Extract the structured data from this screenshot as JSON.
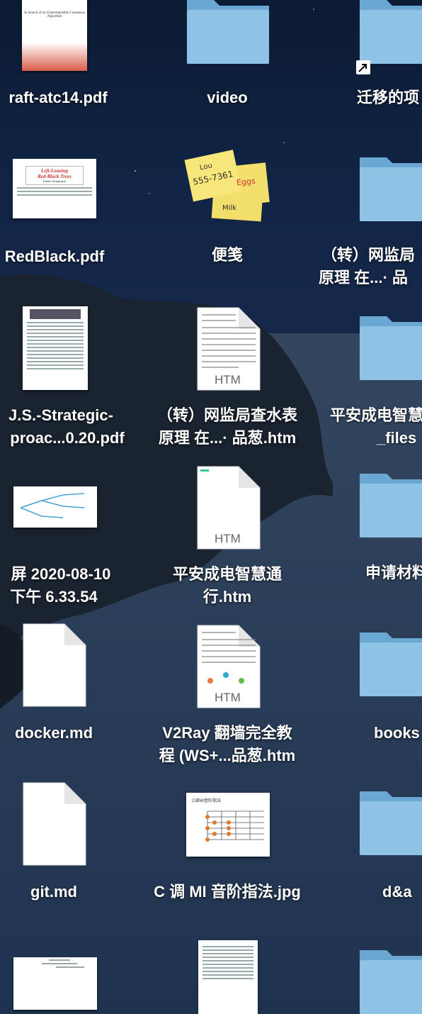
{
  "desktop": {
    "labels": {
      "r1c1": "raft-atc14.pdf",
      "r1c2": "video",
      "r1c3": "迁移的项",
      "r2c1": "RedBlack.pdf",
      "r2c2": "便笺",
      "r2c3_l1": "（转）网监局",
      "r2c3_l2": "原理 在...· 品",
      "r3c1_l1": "J.S.-Strategic-",
      "r3c1_l2": "proac...0.20.pdf",
      "r3c2_l1": "（转）网监局查水表",
      "r3c2_l2": "原理 在...· 品葱.htm",
      "r3c3_l1": "平安成电智慧",
      "r3c3_l2": "_files",
      "r4c1_l1": "屏 2020-08-10",
      "r4c1_l2": "下午 6.33.54",
      "r4c2_l1": "平安成电智慧通",
      "r4c2_l2": "行.htm",
      "r4c3": "申请材料",
      "r5c1": "docker.md",
      "r5c2_l1": "V2Ray 翻墙完全教",
      "r5c2_l2": "程 (WS+...品葱.htm",
      "r5c3": "books",
      "r6c1": "git.md",
      "r6c2": "C 调 MI 音阶指法.jpg",
      "r6c3": "d&a"
    },
    "doc_text": {
      "pdf1_title": "In Search of an Understandable Consensus Algorithm",
      "pdf2_title1": "Left-Leaning",
      "pdf2_title2": "Red-Black Trees",
      "pdf2_author": "Robert Sedgewick",
      "sticky_line1": "Lou",
      "sticky_line2": "555-7361",
      "sticky_eggs": "Eggs",
      "sticky_milk": "Milk",
      "htm_badge": "HTM",
      "jpg_title": "C调MI音阶指法"
    }
  }
}
